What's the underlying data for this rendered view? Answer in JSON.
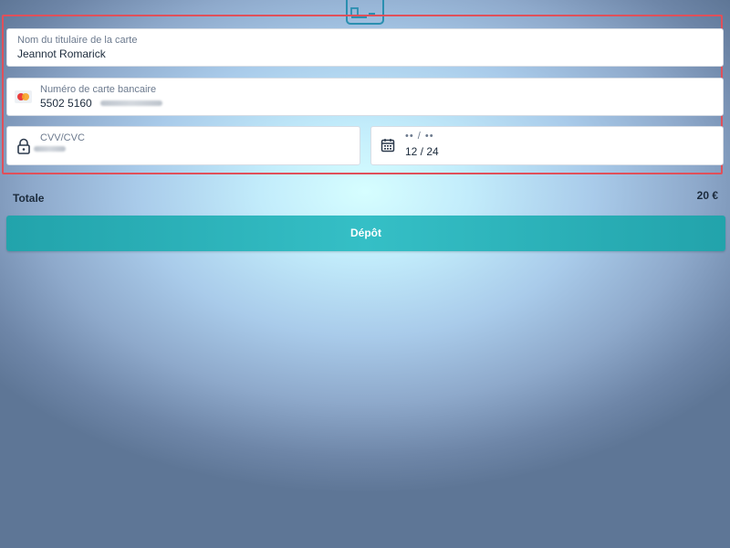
{
  "header": {
    "icon": "credit-card-icon"
  },
  "form": {
    "cardholder": {
      "label": "Nom du titulaire de la carte",
      "value": "Jeannot Romarick"
    },
    "card_number": {
      "label": "Numéro de carte bancaire",
      "value": "5502 5160",
      "icon": "mastercard-icon"
    },
    "cvv": {
      "label": "CVV/CVC",
      "icon": "lock-icon"
    },
    "expiry": {
      "placeholder": "•• / ••",
      "value": "12 / 24",
      "icon": "calendar-icon"
    }
  },
  "summary": {
    "total_label": "Totale",
    "total_value": "20 €"
  },
  "actions": {
    "deposit_label": "Dépôt"
  },
  "colors": {
    "accent": "#2fb5bd",
    "highlight_border": "#e0505a"
  }
}
